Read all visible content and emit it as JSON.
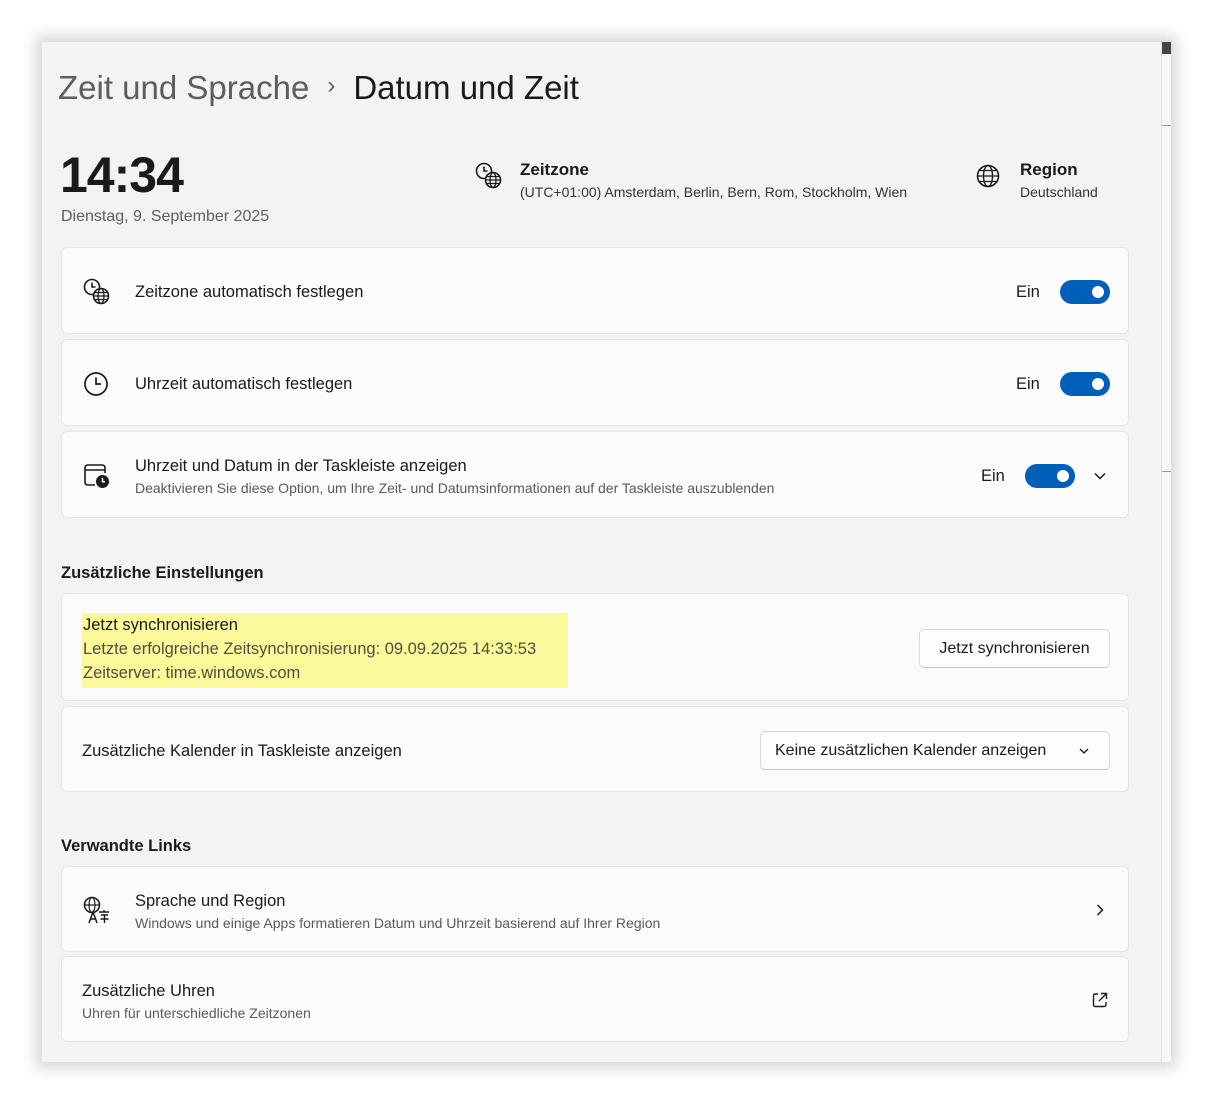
{
  "breadcrumb": {
    "parent": "Zeit und Sprache",
    "separator": "›",
    "current": "Datum und Zeit"
  },
  "clock": {
    "time": "14:34",
    "date": "Dienstag, 9. September 2025"
  },
  "timezone": {
    "title": "Zeitzone",
    "value": "(UTC+01:00) Amsterdam, Berlin, Bern, Rom, Stockholm, Wien",
    "icon": "clock-globe-icon"
  },
  "region": {
    "title": "Region",
    "value": "Deutschland",
    "icon": "globe-icon"
  },
  "settings": [
    {
      "label": "Zeitzone automatisch festlegen",
      "state": "Ein",
      "on": true,
      "icon": "clock-globe-icon"
    },
    {
      "label": "Uhrzeit automatisch festlegen",
      "state": "Ein",
      "on": true,
      "icon": "clock-icon"
    },
    {
      "label": "Uhrzeit und Datum in der Taskleiste anzeigen",
      "sub": "Deaktivieren Sie diese Option, um Ihre Zeit- und Datumsinformationen auf der Taskleiste auszublenden",
      "state": "Ein",
      "on": true,
      "icon": "calendar-clock-icon"
    }
  ],
  "additional": {
    "title": "Zusätzliche Einstellungen",
    "sync": {
      "title": "Jetzt synchronisieren",
      "last_sync": "Letzte erfolgreiche Zeitsynchronisierung: 09.09.2025 14:33:53",
      "server": "Zeitserver: time.windows.com",
      "button": "Jetzt synchronisieren",
      "highlight_color": "#fafa9a"
    },
    "calendar": {
      "label": "Zusätzliche Kalender in Taskleiste anzeigen",
      "selected": "Keine zusätzlichen Kalender anzeigen"
    }
  },
  "related": {
    "title": "Verwandte Links",
    "items": [
      {
        "label": "Sprache und Region",
        "sub": "Windows und einige Apps formatieren Datum und Uhrzeit basierend auf Ihrer Region",
        "icon": "language-icon"
      },
      {
        "label": "Zusätzliche Uhren",
        "sub": "Uhren für unterschiedliche Zeitzonen",
        "icon": "external-link-icon"
      }
    ]
  },
  "colors": {
    "accent": "#005fb8",
    "background": "#f3f3f3",
    "card": "#fbfbfb"
  }
}
